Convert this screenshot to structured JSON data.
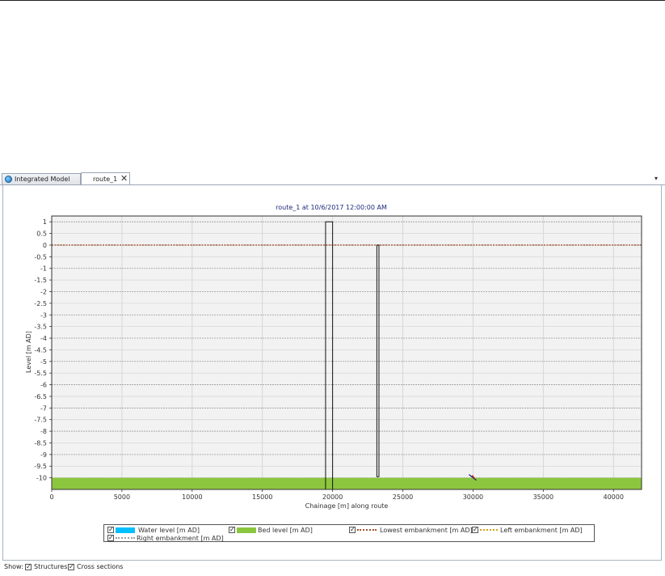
{
  "tabs": {
    "integrated_model": "Integrated Model",
    "route": "route_1",
    "close_glyph": "✕",
    "menu_glyph": "▾"
  },
  "colors": {
    "water": "#00bfff",
    "bed": "#8cc63f",
    "lowest_embankment": "#a0522d",
    "left_embankment": "#d4a017",
    "right_embankment": "#9e9e9e",
    "plot_bg": "#f2f2f2",
    "title_color": "#1c2a7a"
  },
  "legend": {
    "water_level": "Water level [m AD]",
    "bed_level": "Bed level [m AD]",
    "lowest_embankment": "Lowest embankment [m AD]",
    "left_embankment": "Left embankment [m AD]",
    "right_embankment": "Right embankment [m AD]",
    "check_glyph": "✓"
  },
  "footer": {
    "show_label": "Show:",
    "structures": "Structures",
    "cross_sections": "Cross sections"
  },
  "chart_data": {
    "type": "line",
    "title": "route_1 at 10/6/2017 12:00:00 AM",
    "xlabel": "Chainage [m] along route",
    "ylabel": "Level [m AD]",
    "xlim": [
      0,
      42000
    ],
    "ylim": [
      -10.5,
      1.25
    ],
    "x_ticks": [
      0,
      5000,
      10000,
      15000,
      20000,
      25000,
      30000,
      35000,
      40000
    ],
    "y_ticks": [
      1,
      0.5,
      0,
      -0.5,
      -1,
      -1.5,
      -2,
      -2.5,
      -3,
      -3.5,
      -4,
      -4.5,
      -5,
      -5.5,
      -6,
      -6.5,
      -7,
      -7.5,
      -8,
      -8.5,
      -9,
      -9.5,
      -10
    ],
    "grid": true,
    "series": [
      {
        "name": "Bed level [m AD]",
        "x": [
          0,
          42000
        ],
        "y": [
          -10.0,
          -10.0
        ]
      },
      {
        "name": "Lowest embankment [m AD]",
        "x": [
          0,
          42000
        ],
        "y": [
          0,
          0
        ]
      }
    ],
    "structures": [
      {
        "x_start": 19500,
        "x_end": 20000,
        "top": 1.0,
        "bottom": -10.5
      },
      {
        "x_start": 23150,
        "x_end": 23300,
        "top": 0.0,
        "bottom": -9.95
      }
    ],
    "marker": {
      "x": 30000,
      "y": -10.0
    }
  }
}
